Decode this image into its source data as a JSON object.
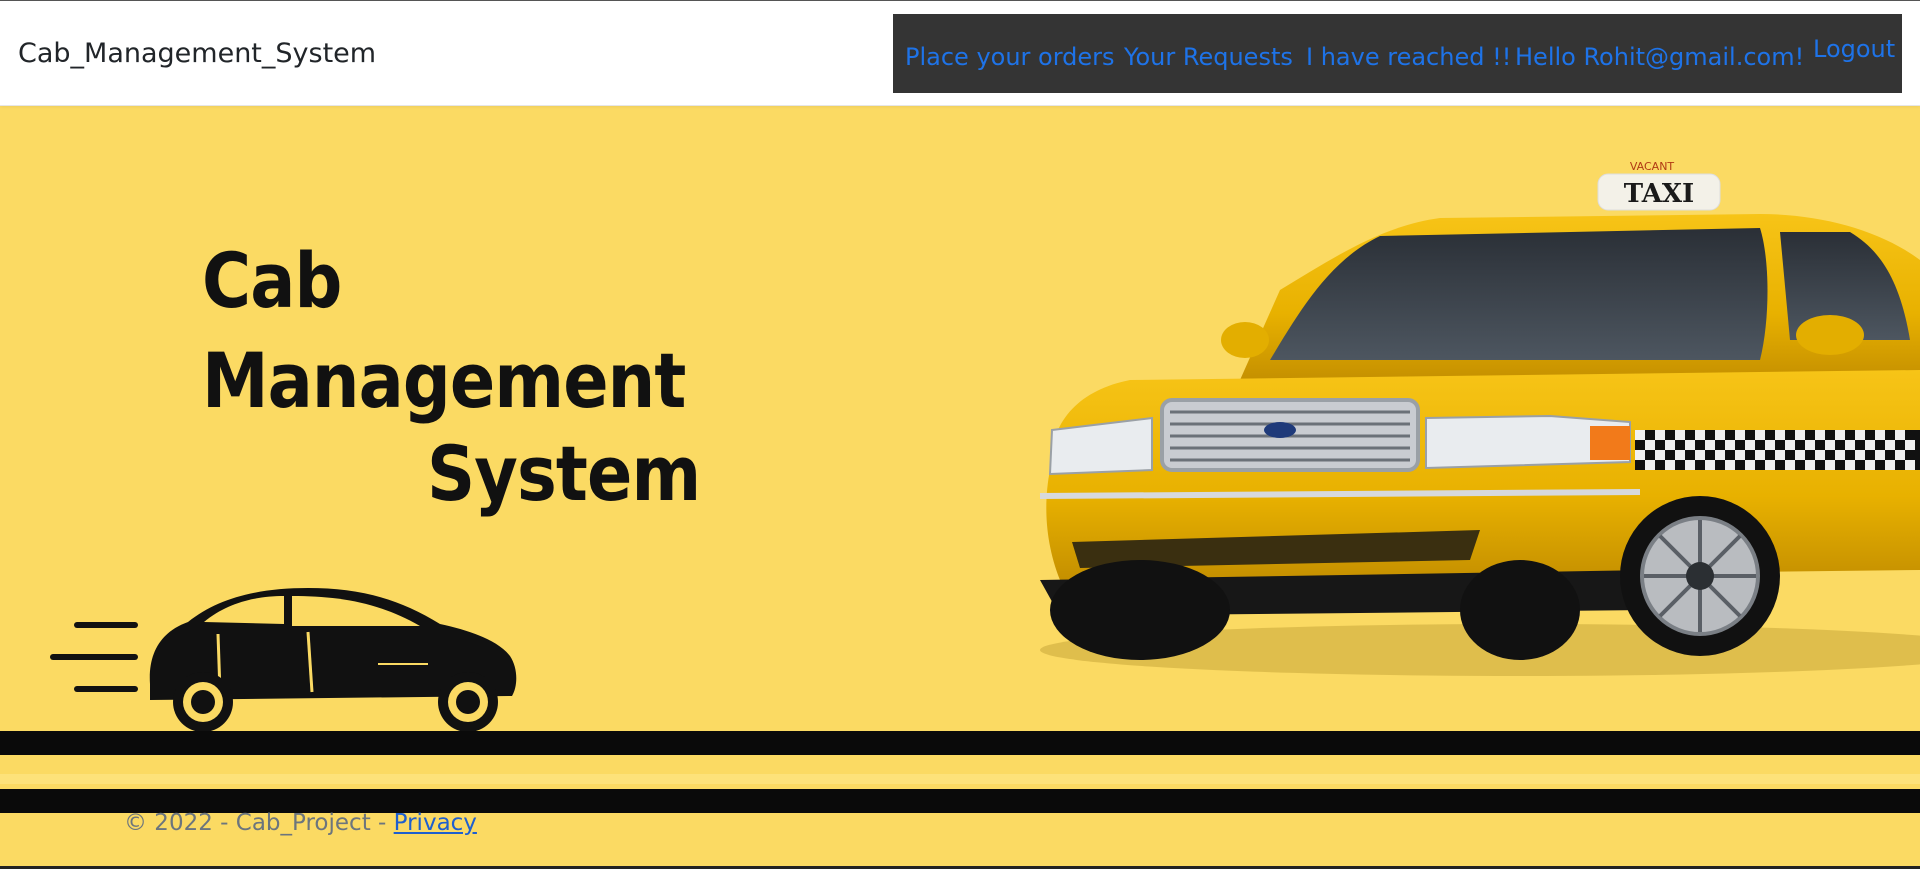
{
  "navbar": {
    "brand": "Cab_Management_System",
    "links": [
      {
        "label": "Place your orders"
      },
      {
        "label": "Your Requests"
      },
      {
        "label": "I have reached !!"
      },
      {
        "label": "Hello Rohit@gmail.com!"
      }
    ],
    "logout_label": "Logout",
    "link_color": "#1e73e8",
    "dark_bg": "#343434"
  },
  "hero": {
    "background": "#fbda63",
    "title_line1": "Cab",
    "title_line2": "Management",
    "title_line3": "System",
    "taxi_sign": "TAXI",
    "taxi_sign_top": "VACANT"
  },
  "footer": {
    "text": "© 2022 - Cab_Project - ",
    "privacy_label": "Privacy"
  }
}
